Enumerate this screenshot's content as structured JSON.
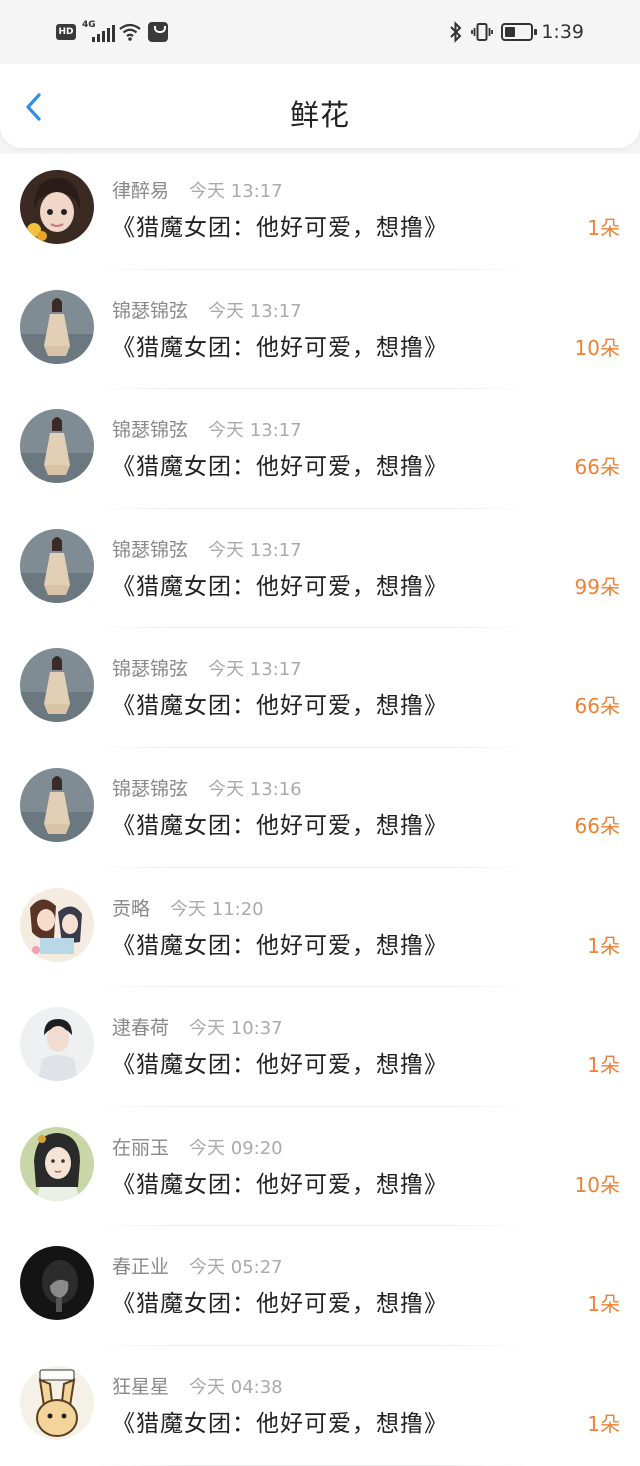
{
  "status_bar": {
    "hd": "HD",
    "network": "4G",
    "time": "1:39"
  },
  "header": {
    "title": "鲜花"
  },
  "colors": {
    "accent_blue": "#2f8fe8",
    "count_orange": "#ee8133"
  },
  "items": [
    {
      "name": "律醉易",
      "time": "今天 13:17",
      "text": "《猎魔女团：他好可爱，想撸》",
      "count": "1朵",
      "avatar": "girl-selfie"
    },
    {
      "name": "锦瑟锦弦",
      "time": "今天 13:17",
      "text": "《猎魔女团：他好可爱，想撸》",
      "count": "10朵",
      "avatar": "dress-girl"
    },
    {
      "name": "锦瑟锦弦",
      "time": "今天 13:17",
      "text": "《猎魔女团：他好可爱，想撸》",
      "count": "66朵",
      "avatar": "dress-girl"
    },
    {
      "name": "锦瑟锦弦",
      "time": "今天 13:17",
      "text": "《猎魔女团：他好可爱，想撸》",
      "count": "99朵",
      "avatar": "dress-girl"
    },
    {
      "name": "锦瑟锦弦",
      "time": "今天 13:17",
      "text": "《猎魔女团：他好可爱，想撸》",
      "count": "66朵",
      "avatar": "dress-girl"
    },
    {
      "name": "锦瑟锦弦",
      "time": "今天 13:16",
      "text": "《猎魔女团：他好可爱，想撸》",
      "count": "66朵",
      "avatar": "dress-girl"
    },
    {
      "name": "贡略",
      "time": "今天 11:20",
      "text": "《猎魔女团：他好可爱，想撸》",
      "count": "1朵",
      "avatar": "anime-couple"
    },
    {
      "name": "逮春荷",
      "time": "今天 10:37",
      "text": "《猎魔女团：他好可爱，想撸》",
      "count": "1朵",
      "avatar": "boy-portrait"
    },
    {
      "name": "在丽玉",
      "time": "今天 09:20",
      "text": "《猎魔女团：他好可爱，想撸》",
      "count": "10朵",
      "avatar": "ancient-lady"
    },
    {
      "name": "春正业",
      "time": "今天 05:27",
      "text": "《猎魔女团：他好可爱，想撸》",
      "count": "1朵",
      "avatar": "dark-hand"
    },
    {
      "name": "狂星星",
      "time": "今天 04:38",
      "text": "《猎魔女团：他好可爱，想撸》",
      "count": "1朵",
      "avatar": "cartoon-rabbit"
    }
  ]
}
